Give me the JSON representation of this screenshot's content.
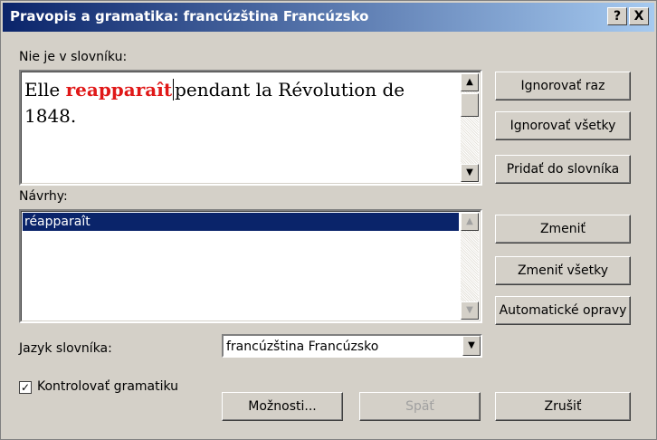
{
  "window": {
    "title": "Pravopis a gramatika: francúzština Francúzsko",
    "help_btn": "?",
    "close_btn": "X"
  },
  "not_in_dict": {
    "label": "Nie je v slovníku:",
    "text_before": "Elle ",
    "error_word": "reapparaît",
    "text_after": "pendant la Révolution de",
    "line2": "1848."
  },
  "suggestions": {
    "label": "Návrhy:",
    "items": [
      "réapparaît"
    ]
  },
  "dictionary": {
    "label": "Jazyk slovníka:",
    "value": "francúzština Francúzsko"
  },
  "grammar": {
    "label": "Kontrolovať gramatiku",
    "checked": true,
    "check_glyph": "✓"
  },
  "buttons": {
    "ignore_once": "Ignorovať raz",
    "ignore_all": "Ignorovať všetky",
    "add_dict": "Pridať do slovníka",
    "change": "Zmeniť",
    "change_all": "Zmeniť všetky",
    "autocorrect": "Automatické opravy",
    "options": "Možnosti...",
    "undo": "Späť",
    "cancel": "Zrušiť"
  }
}
